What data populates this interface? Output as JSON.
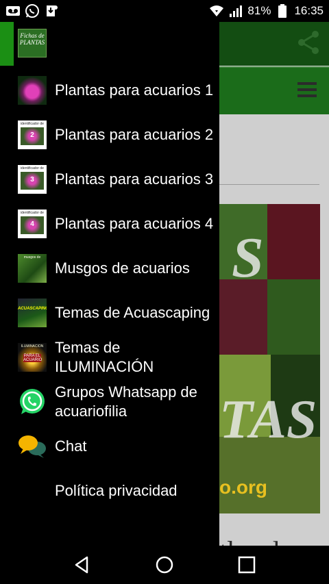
{
  "status_bar": {
    "battery_percent": "81%",
    "time": "16:35",
    "left_icons": [
      "voicemail-icon",
      "whatsapp-icon",
      "download-icon"
    ],
    "right_icons": [
      "wifi-icon",
      "signal-icon",
      "battery-icon"
    ]
  },
  "drawer": {
    "logo_text": "Fichas de PLANTAS",
    "items": [
      {
        "label": "Plantas para acuarios 1",
        "icon": "plants-thumbnail-1",
        "thumb_text": ""
      },
      {
        "label": "Plantas para acuarios 2",
        "icon": "plants-thumbnail-2",
        "thumb_text": "identificador de",
        "thumb_num": "2"
      },
      {
        "label": "Plantas para acuarios 3",
        "icon": "plants-thumbnail-3",
        "thumb_text": "identificador de",
        "thumb_num": "3"
      },
      {
        "label": "Plantas para acuarios 4",
        "icon": "plants-thumbnail-4",
        "thumb_text": "identificador de",
        "thumb_num": "4"
      },
      {
        "label": "Musgos de acuarios",
        "icon": "moss-thumbnail",
        "thumb_text": "musgos de"
      },
      {
        "label": "Temas de Acuascaping",
        "icon": "aquascaping-thumbnail",
        "thumb_text": "ACUASCAPING"
      },
      {
        "label": "Temas de ILUMINACIÓN",
        "icon": "lighting-thumbnail",
        "thumb_text": "ILUMINACION",
        "thumb_mid": "PARA EL ACUARIO"
      },
      {
        "label": "Grupos Whatsapp de acuariofilia",
        "icon": "whatsapp-icon"
      },
      {
        "label": "Chat",
        "icon": "chat-bubbles-icon"
      },
      {
        "label": "Política privacidad",
        "icon": ""
      }
    ]
  },
  "background_app": {
    "image_text_top": "S",
    "image_text_bottom": "TAS",
    "image_url_text": "o.org",
    "heading_peek": "tlos de"
  },
  "colors": {
    "toolbar": "#134d12",
    "menu_bar": "#1b6c1a",
    "drawer_bg": "#000000",
    "drawer_accent": "#1b8f14",
    "whatsapp": "#25d366",
    "chat": "#f4b400"
  }
}
